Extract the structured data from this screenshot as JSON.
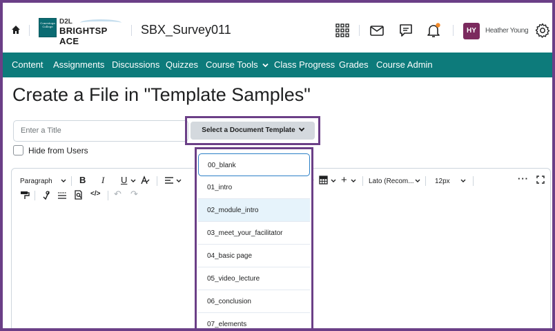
{
  "header": {
    "logo_top": "D2L",
    "logo_main": "BRIGHTSP ACE",
    "logo_crest_text": "Conestoga College",
    "course_title": "SBX_Survey011",
    "user_initials": "HY",
    "user_name": "Heather Young"
  },
  "nav": {
    "items": [
      {
        "label": "Content"
      },
      {
        "label": "Assignments"
      },
      {
        "label": "Discussions"
      },
      {
        "label": "Quizzes"
      },
      {
        "label": "Course Tools"
      },
      {
        "label": "Class Progress"
      },
      {
        "label": "Grades"
      },
      {
        "label": "Course Admin"
      }
    ]
  },
  "page": {
    "title": "Create a File in \"Template Samples\"",
    "title_placeholder": "Enter a Title",
    "template_button": "Select a Document Template",
    "hide_label": "Hide from Users"
  },
  "editor": {
    "block_format": "Paragraph",
    "font": "Lato (Recom...",
    "size": "12px"
  },
  "dropdown": {
    "items": [
      {
        "label": "00_blank"
      },
      {
        "label": "01_intro"
      },
      {
        "label": "02_module_intro"
      },
      {
        "label": "03_meet_your_facilitator"
      },
      {
        "label": "04_basic page"
      },
      {
        "label": "05_video_lecture"
      },
      {
        "label": "06_conclusion"
      },
      {
        "label": "07_elements"
      }
    ],
    "highlighted_index": 2
  },
  "colors": {
    "frame": "#6b3f87",
    "navbar": "#0d7b7b",
    "avatar": "#7b2a5e",
    "notification_dot": "#f18a2a"
  }
}
